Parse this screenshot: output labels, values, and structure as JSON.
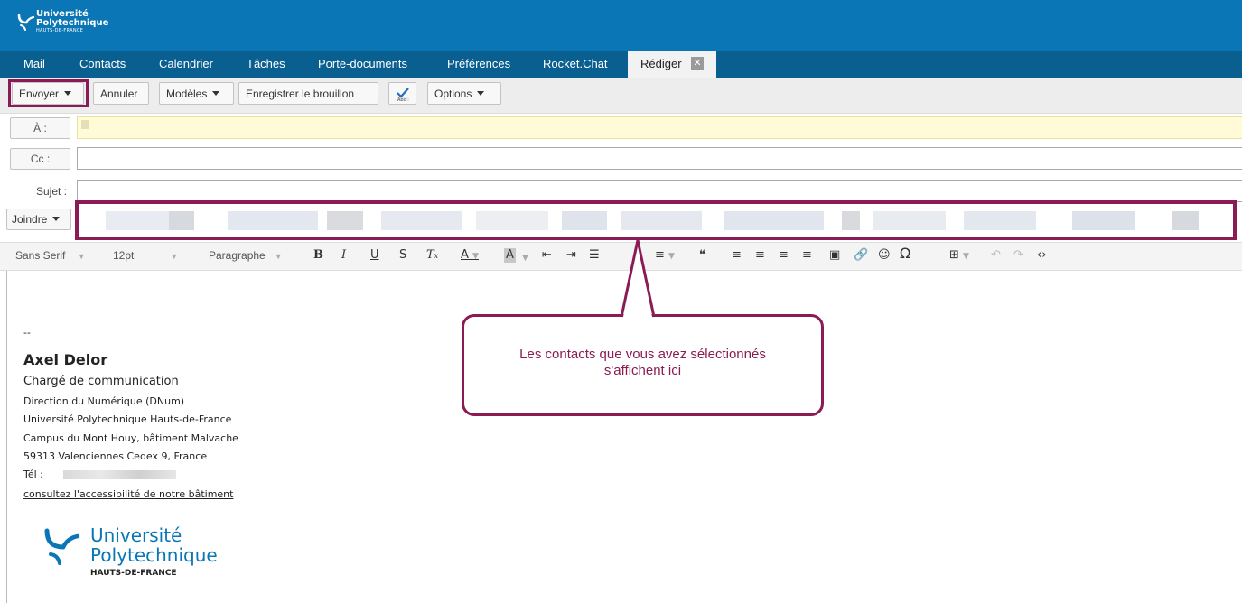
{
  "header": {
    "logo_line1": "Université",
    "logo_line2": "Polytechnique",
    "logo_line3": "HAUTS-DE-FRANCE"
  },
  "nav": {
    "tabs": [
      "Mail",
      "Contacts",
      "Calendrier",
      "Tâches",
      "Porte-documents",
      "Préférences",
      "Rocket.Chat"
    ],
    "active_tab": "Rédiger",
    "active_close": "✕"
  },
  "toolbar": {
    "send": "Envoyer",
    "cancel": "Annuler",
    "templates": "Modèles",
    "save_draft": "Enregistrer le brouillon",
    "options": "Options"
  },
  "fields": {
    "to_label": "À :",
    "cc_label": "Cc :",
    "subject_label": "Sujet :",
    "attach_label": "Joindre"
  },
  "format": {
    "font": "Sans Serif",
    "size": "12pt",
    "block": "Paragraphe"
  },
  "signature": {
    "dashes": "--",
    "name": "Axel Delor",
    "role": "Chargé de communication",
    "lines": [
      "Direction du Numérique (DNum)",
      "Université Polytechnique Hauts-de-France",
      "Campus du Mont Houy, bâtiment Malvache",
      "59313 Valenciennes Cedex 9, France"
    ],
    "tel_label": "Tél :",
    "link": "consultez l'accessibilité de notre bâtiment",
    "logo_line1": "Université",
    "logo_line2": "Polytechnique",
    "logo_line3": "HAUTS-DE-FRANCE"
  },
  "callout": {
    "line1": "Les contacts que vous avez sélectionnés",
    "line2": "s'affichent ici"
  },
  "colors": {
    "header_bg": "#0a76b5",
    "nav_bg": "#0a5f91",
    "highlight": "#8a1b54",
    "logo_blue": "#0a76b5"
  }
}
